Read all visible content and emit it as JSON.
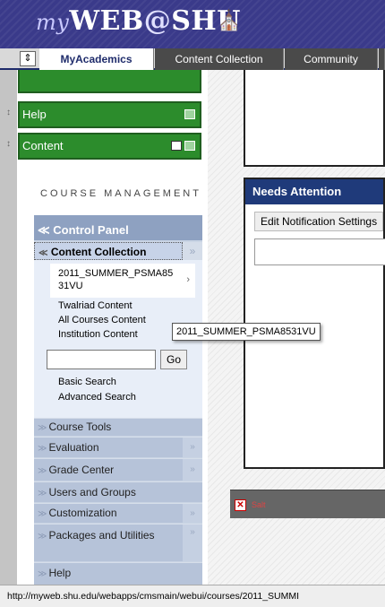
{
  "header": {
    "logo_my": "my",
    "logo_web": "WEB",
    "logo_at": "@",
    "logo_shu": "SHU",
    "tabs": [
      {
        "label": "MyAcademics"
      },
      {
        "label": "Content Collection"
      },
      {
        "label": "Community"
      }
    ]
  },
  "sidebar": {
    "green_buttons": [
      {
        "label": "Help"
      },
      {
        "label": "Content"
      }
    ],
    "course_management_title": "COURSE MANAGEMENT",
    "control_panel": {
      "title": "Control Panel",
      "content_collection": {
        "label": "Content Collection",
        "selected_item": "2011_SUMMER_PSMA8531VU",
        "items": [
          "Twalriad Content",
          "All Courses Content",
          "Institution Content"
        ],
        "search_value": "",
        "go_label": "Go",
        "links": [
          "Basic Search",
          "Advanced Search"
        ]
      },
      "sections": [
        {
          "label": "Course Tools"
        },
        {
          "label": "Evaluation"
        },
        {
          "label": "Grade Center"
        },
        {
          "label": "Users and Groups"
        },
        {
          "label": "Customization"
        },
        {
          "label": "Packages and Utilities"
        },
        {
          "label": "Help"
        }
      ]
    }
  },
  "main": {
    "needs_attention": {
      "title": "Needs Attention",
      "button": "Edit Notification Settings"
    },
    "footer_label": "Salt"
  },
  "tooltip": "2011_SUMMER_PSMA8531VU",
  "status_bar": "http://myweb.shu.edu/webapps/cmsmain/webui/courses/2011_SUMMI"
}
